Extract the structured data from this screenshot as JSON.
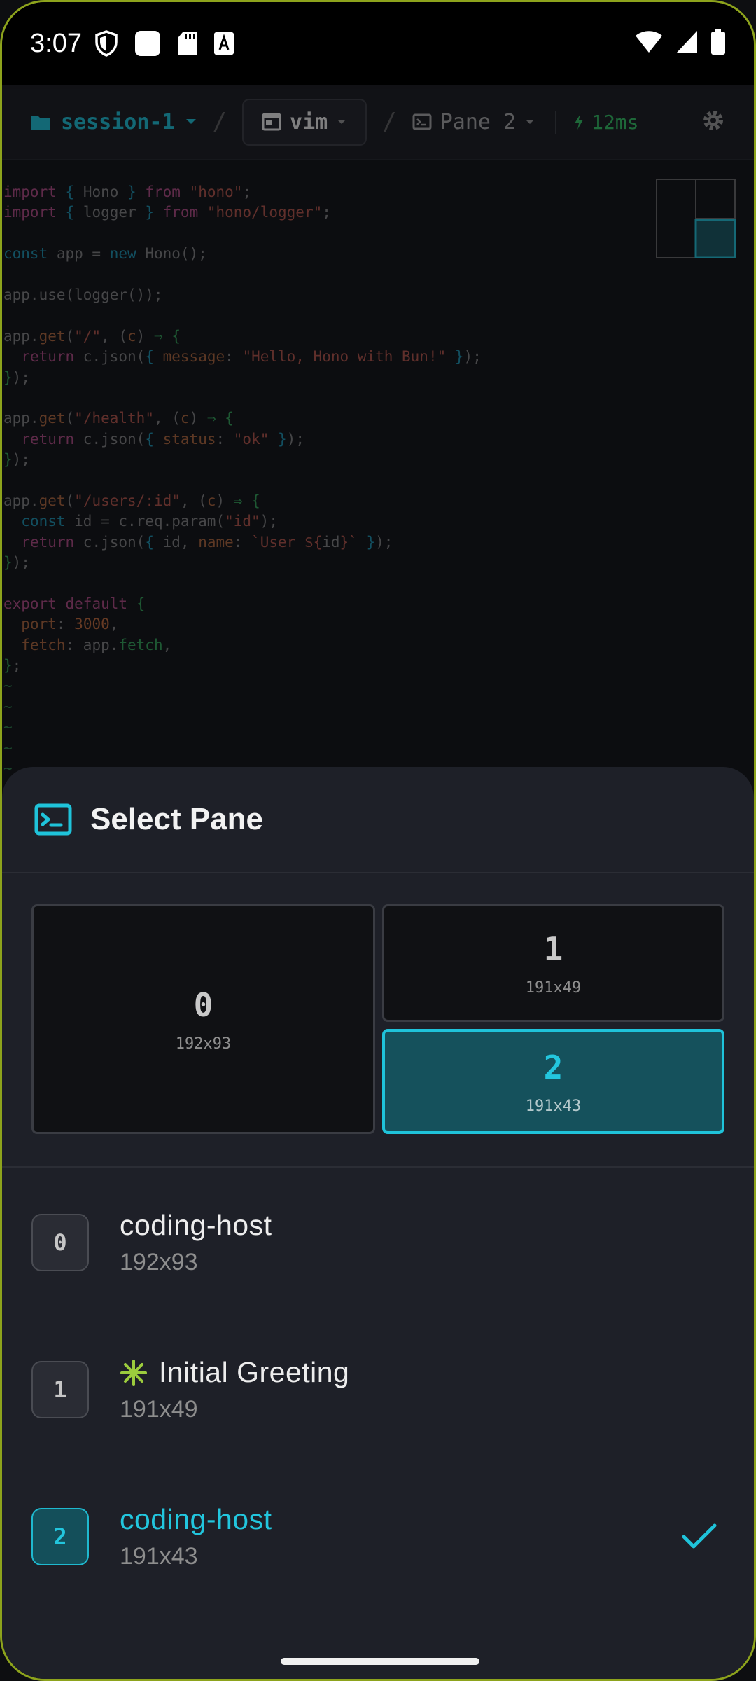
{
  "status_bar": {
    "time": "3:07",
    "left_icons": [
      "shield-icon",
      "square-app-icon",
      "sd-card-icon",
      "font-icon"
    ],
    "right_icons": [
      "wifi-icon",
      "signal-icon",
      "battery-icon"
    ]
  },
  "toolbar": {
    "session": "session-1",
    "separator": "/",
    "window": "vim",
    "pane": "Pane 2",
    "latency": "12ms"
  },
  "code_lines": [
    {
      "segs": [
        {
          "c": "kw",
          "t": "import"
        },
        {
          "c": "",
          "t": " "
        },
        {
          "c": "fn",
          "t": "{"
        },
        {
          "c": "",
          "t": " Hono "
        },
        {
          "c": "fn",
          "t": "}"
        },
        {
          "c": "",
          "t": " "
        },
        {
          "c": "kw",
          "t": "from"
        },
        {
          "c": "",
          "t": " "
        },
        {
          "c": "str",
          "t": "\"hono\""
        },
        {
          "c": "",
          "t": ";"
        }
      ]
    },
    {
      "segs": [
        {
          "c": "kw",
          "t": "import"
        },
        {
          "c": "",
          "t": " "
        },
        {
          "c": "fn",
          "t": "{"
        },
        {
          "c": "",
          "t": " logger "
        },
        {
          "c": "fn",
          "t": "}"
        },
        {
          "c": "",
          "t": " "
        },
        {
          "c": "kw",
          "t": "from"
        },
        {
          "c": "",
          "t": " "
        },
        {
          "c": "str",
          "t": "\"hono/logger\""
        },
        {
          "c": "",
          "t": ";"
        }
      ]
    },
    {
      "segs": []
    },
    {
      "segs": [
        {
          "c": "fn",
          "t": "const"
        },
        {
          "c": "",
          "t": " app = "
        },
        {
          "c": "fn",
          "t": "new"
        },
        {
          "c": "",
          "t": " Hono();"
        }
      ]
    },
    {
      "segs": []
    },
    {
      "segs": [
        {
          "c": "",
          "t": "app.use(logger());"
        }
      ]
    },
    {
      "segs": []
    },
    {
      "segs": [
        {
          "c": "",
          "t": "app."
        },
        {
          "c": "prop",
          "t": "get"
        },
        {
          "c": "",
          "t": "("
        },
        {
          "c": "str",
          "t": "\"/\""
        },
        {
          "c": "",
          "t": ", ("
        },
        {
          "c": "prop",
          "t": "c"
        },
        {
          "c": "",
          "t": ") "
        },
        {
          "c": "gn",
          "t": "⇒"
        },
        {
          "c": "",
          "t": " "
        },
        {
          "c": "gn",
          "t": "{"
        }
      ]
    },
    {
      "segs": [
        {
          "c": "",
          "t": "  "
        },
        {
          "c": "kw",
          "t": "return"
        },
        {
          "c": "",
          "t": " c.json("
        },
        {
          "c": "fn",
          "t": "{"
        },
        {
          "c": "",
          "t": " "
        },
        {
          "c": "prop",
          "t": "message"
        },
        {
          "c": "",
          "t": ": "
        },
        {
          "c": "str",
          "t": "\"Hello, Hono with Bun!\""
        },
        {
          "c": "",
          "t": " "
        },
        {
          "c": "fn",
          "t": "}"
        },
        {
          "c": "",
          "t": ");"
        }
      ]
    },
    {
      "segs": [
        {
          "c": "gn",
          "t": "}"
        },
        {
          "c": "",
          "t": ");"
        }
      ]
    },
    {
      "segs": []
    },
    {
      "segs": [
        {
          "c": "",
          "t": "app."
        },
        {
          "c": "prop",
          "t": "get"
        },
        {
          "c": "",
          "t": "("
        },
        {
          "c": "str",
          "t": "\"/health\""
        },
        {
          "c": "",
          "t": ", ("
        },
        {
          "c": "prop",
          "t": "c"
        },
        {
          "c": "",
          "t": ") "
        },
        {
          "c": "gn",
          "t": "⇒"
        },
        {
          "c": "",
          "t": " "
        },
        {
          "c": "gn",
          "t": "{"
        }
      ]
    },
    {
      "segs": [
        {
          "c": "",
          "t": "  "
        },
        {
          "c": "kw",
          "t": "return"
        },
        {
          "c": "",
          "t": " c.json("
        },
        {
          "c": "fn",
          "t": "{"
        },
        {
          "c": "",
          "t": " "
        },
        {
          "c": "prop",
          "t": "status"
        },
        {
          "c": "",
          "t": ": "
        },
        {
          "c": "str",
          "t": "\"ok\""
        },
        {
          "c": "",
          "t": " "
        },
        {
          "c": "fn",
          "t": "}"
        },
        {
          "c": "",
          "t": ");"
        }
      ]
    },
    {
      "segs": [
        {
          "c": "gn",
          "t": "}"
        },
        {
          "c": "",
          "t": ");"
        }
      ]
    },
    {
      "segs": []
    },
    {
      "segs": [
        {
          "c": "",
          "t": "app."
        },
        {
          "c": "prop",
          "t": "get"
        },
        {
          "c": "",
          "t": "("
        },
        {
          "c": "str",
          "t": "\"/users/:id\""
        },
        {
          "c": "",
          "t": ", ("
        },
        {
          "c": "prop",
          "t": "c"
        },
        {
          "c": "",
          "t": ") "
        },
        {
          "c": "gn",
          "t": "⇒"
        },
        {
          "c": "",
          "t": " "
        },
        {
          "c": "gn",
          "t": "{"
        }
      ]
    },
    {
      "segs": [
        {
          "c": "",
          "t": "  "
        },
        {
          "c": "fn",
          "t": "const"
        },
        {
          "c": "",
          "t": " id = c.req.param("
        },
        {
          "c": "str",
          "t": "\"id\""
        },
        {
          "c": "",
          "t": ");"
        }
      ]
    },
    {
      "segs": [
        {
          "c": "",
          "t": "  "
        },
        {
          "c": "kw",
          "t": "return"
        },
        {
          "c": "",
          "t": " c.json("
        },
        {
          "c": "fn",
          "t": "{"
        },
        {
          "c": "",
          "t": " id, "
        },
        {
          "c": "prop",
          "t": "name"
        },
        {
          "c": "",
          "t": ": "
        },
        {
          "c": "str",
          "t": "`User ${"
        },
        {
          "c": "",
          "t": "id"
        },
        {
          "c": "str",
          "t": "}`"
        },
        {
          "c": "",
          "t": " "
        },
        {
          "c": "fn",
          "t": "}"
        },
        {
          "c": "",
          "t": ");"
        }
      ]
    },
    {
      "segs": [
        {
          "c": "gn",
          "t": "}"
        },
        {
          "c": "",
          "t": ");"
        }
      ]
    },
    {
      "segs": []
    },
    {
      "segs": [
        {
          "c": "kw",
          "t": "export"
        },
        {
          "c": "",
          "t": " "
        },
        {
          "c": "kw",
          "t": "default"
        },
        {
          "c": "",
          "t": " "
        },
        {
          "c": "gn",
          "t": "{"
        }
      ]
    },
    {
      "segs": [
        {
          "c": "",
          "t": "  "
        },
        {
          "c": "prop",
          "t": "port"
        },
        {
          "c": "",
          "t": ": "
        },
        {
          "c": "num",
          "t": "3000"
        },
        {
          "c": "",
          "t": ","
        }
      ]
    },
    {
      "segs": [
        {
          "c": "",
          "t": "  "
        },
        {
          "c": "prop",
          "t": "fetch"
        },
        {
          "c": "",
          "t": ": app."
        },
        {
          "c": "gn",
          "t": "fetch"
        },
        {
          "c": "",
          "t": ","
        }
      ]
    },
    {
      "segs": [
        {
          "c": "gn",
          "t": "}"
        },
        {
          "c": "",
          "t": ";"
        }
      ]
    },
    {
      "segs": [
        {
          "c": "tilde",
          "t": "~"
        }
      ]
    },
    {
      "segs": [
        {
          "c": "tilde",
          "t": "~"
        }
      ]
    },
    {
      "segs": [
        {
          "c": "tilde",
          "t": "~"
        }
      ]
    },
    {
      "segs": [
        {
          "c": "tilde",
          "t": "~"
        }
      ]
    },
    {
      "segs": [
        {
          "c": "tilde",
          "t": "~"
        }
      ]
    }
  ],
  "sheet": {
    "title": "Select Pane",
    "layout_panes": [
      {
        "id": "0",
        "dims": "192x93",
        "active": false
      },
      {
        "id": "1",
        "dims": "191x49",
        "active": false
      },
      {
        "id": "2",
        "dims": "191x43",
        "active": true
      }
    ],
    "pane_list": [
      {
        "id": "0",
        "name": "coding-host",
        "dims": "192x93",
        "selected": false,
        "icon": ""
      },
      {
        "id": "1",
        "name": "Initial Greeting",
        "dims": "191x49",
        "selected": false,
        "icon": "sparkle-icon"
      },
      {
        "id": "2",
        "name": "coding-host",
        "dims": "191x43",
        "selected": true,
        "icon": ""
      }
    ]
  },
  "colors": {
    "accent": "#1fc3da",
    "sparkle": "#9ccc3d",
    "latency": "#2db35b",
    "frame": "#8da31c"
  }
}
